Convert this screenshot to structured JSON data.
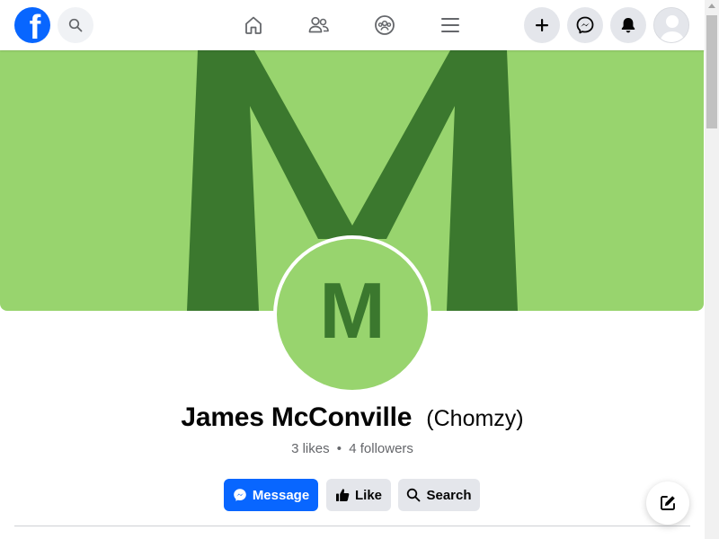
{
  "topbar": {
    "logo_letter": "f",
    "icons": {
      "logo": "facebook-logo-icon",
      "search": "search-icon",
      "home": "home-icon",
      "friends": "friends-icon",
      "groups": "groups-icon",
      "menu": "menu-icon",
      "create": "plus-icon",
      "messenger": "messenger-icon",
      "notifications": "bell-icon",
      "account": "avatar-icon"
    }
  },
  "cover": {
    "letter": "M",
    "background": "#98d46e",
    "letter_color": "#3b782e"
  },
  "profile": {
    "picture_letter": "M",
    "name": "James McConville",
    "alternate_name": "(Chomzy)",
    "likes": "3 likes",
    "separator": "•",
    "followers": "4 followers"
  },
  "actions": {
    "message_label": "Message",
    "like_label": "Like",
    "search_label": "Search"
  },
  "colors": {
    "brand_blue": "#0866ff",
    "button_gray": "#e4e6eb",
    "secondary_text": "#65676b"
  },
  "fab": {
    "icon": "compose-icon"
  }
}
